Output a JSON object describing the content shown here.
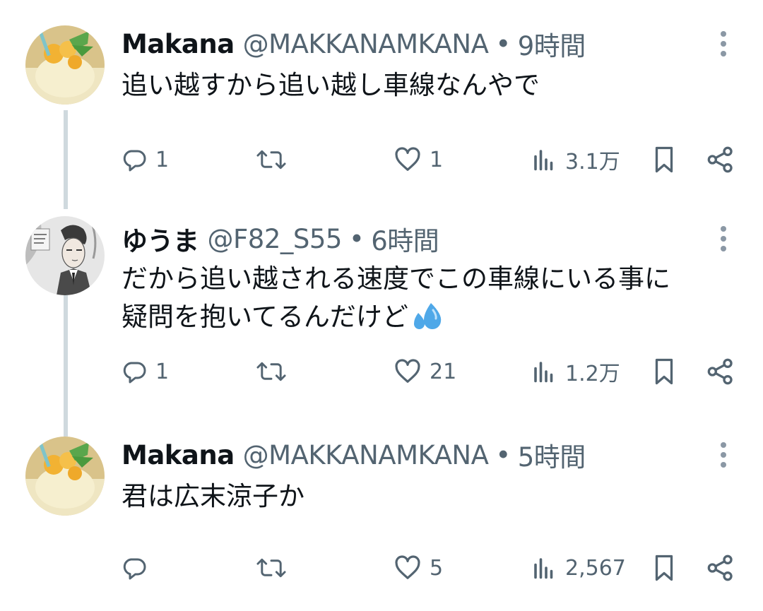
{
  "colors": {
    "text_primary": "#0f1419",
    "text_secondary": "#536471",
    "thread_line": "#cfd9de",
    "background": "#ffffff"
  },
  "tweets": [
    {
      "name": "Makana",
      "handle": "@MAKKANAMKANA",
      "separator": "•",
      "time": "9時間",
      "avatar": "drink-photo-avatar",
      "text_lines": [
        "追い越すから追い越し車線なんやで"
      ],
      "replies": "1",
      "retweets": "",
      "likes": "1",
      "views": "3.1万"
    },
    {
      "name": "ゆうま",
      "handle": "@F82_S55",
      "separator": "•",
      "time": "6時間",
      "avatar": "manga-character-avatar",
      "text_lines": [
        "だから追い越される速度でこの車線にいる事に",
        "疑問を抱いてるんだけど"
      ],
      "emoji": "sweat-droplets-emoji",
      "replies": "1",
      "retweets": "",
      "likes": "21",
      "views": "1.2万"
    },
    {
      "name": "Makana",
      "handle": "@MAKKANAMKANA",
      "separator": "•",
      "time": "5時間",
      "avatar": "drink-photo-avatar",
      "text_lines": [
        "君は広末涼子か"
      ],
      "replies": "",
      "retweets": "",
      "likes": "5",
      "views": "2,567"
    }
  ]
}
